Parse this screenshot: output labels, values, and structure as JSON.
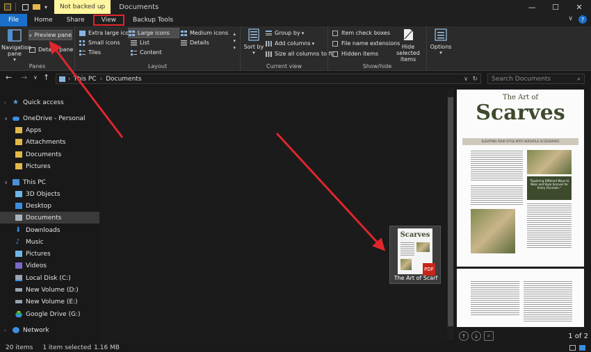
{
  "titlebar": {
    "badge": "Not backed up",
    "title": "Documents",
    "minimize": "—",
    "maximize": "☐",
    "close": "✕"
  },
  "tabs": [
    {
      "label": "File"
    },
    {
      "label": "Home"
    },
    {
      "label": "Share"
    },
    {
      "label": "View"
    },
    {
      "label": "Backup Tools"
    }
  ],
  "tabs_right": {
    "chevron": "∨",
    "help": "?"
  },
  "ribbon": {
    "panes": {
      "label": "Panes",
      "navigation_pane": "Navigation pane",
      "preview_pane": "Preview pane",
      "details_pane": "Details pane"
    },
    "layout": {
      "label": "Layout",
      "items": [
        {
          "label": "Extra large icons"
        },
        {
          "label": "Large icons"
        },
        {
          "label": "Medium icons"
        },
        {
          "label": "Small icons"
        },
        {
          "label": "List"
        },
        {
          "label": "Details"
        },
        {
          "label": "Tiles"
        },
        {
          "label": "Content"
        }
      ]
    },
    "current_view": {
      "label": "Current view",
      "sort_by": "Sort by",
      "group_by": "Group by",
      "add_columns": "Add columns",
      "size_all": "Size all columns to fit"
    },
    "show_hide": {
      "label": "Show/hide",
      "item_check_boxes": "Item check boxes",
      "file_name_extensions": "File name extensions",
      "hidden_items": "Hidden items",
      "hide_selected": "Hide selected items"
    },
    "options": "Options"
  },
  "address": {
    "back": "←",
    "forward": "→",
    "recent": "∨",
    "up": "↑",
    "crumbs": [
      "This PC",
      "Documents"
    ],
    "search_placeholder": "Search Documents"
  },
  "sidebar": {
    "items": [
      {
        "label": "Quick access"
      },
      {
        "label": "OneDrive - Personal"
      },
      {
        "label": "Apps"
      },
      {
        "label": "Attachments"
      },
      {
        "label": "Documents"
      },
      {
        "label": "Pictures"
      },
      {
        "label": "This PC"
      },
      {
        "label": "3D Objects"
      },
      {
        "label": "Desktop"
      },
      {
        "label": "Documents"
      },
      {
        "label": "Downloads"
      },
      {
        "label": "Music"
      },
      {
        "label": "Pictures"
      },
      {
        "label": "Videos"
      },
      {
        "label": "Local Disk (C:)"
      },
      {
        "label": "New Volume (D:)"
      },
      {
        "label": "New Volume (E:)"
      },
      {
        "label": "Google Drive (G:)"
      },
      {
        "label": "Network"
      }
    ]
  },
  "file": {
    "name": "The Art of Scarf",
    "thumb_title": "Scarves",
    "badge": "PDF"
  },
  "preview": {
    "heading_small": "The Art of",
    "heading_big": "Scarves",
    "band": "ELEVATING YOUR STYLE WITH VERSATILE ACCESSORIES",
    "quote": "\"Exploring Different Ways to Wear and Style Scarves for Every Occasion.\"",
    "page_count": "1 of 2"
  },
  "status": {
    "items_count": "20 items",
    "selection": "1 item selected",
    "size": "1.16 MB"
  },
  "colors": {
    "accent": "#1a6fc9",
    "highlight": "#e0262d",
    "brand_green": "#3d4a2c"
  }
}
